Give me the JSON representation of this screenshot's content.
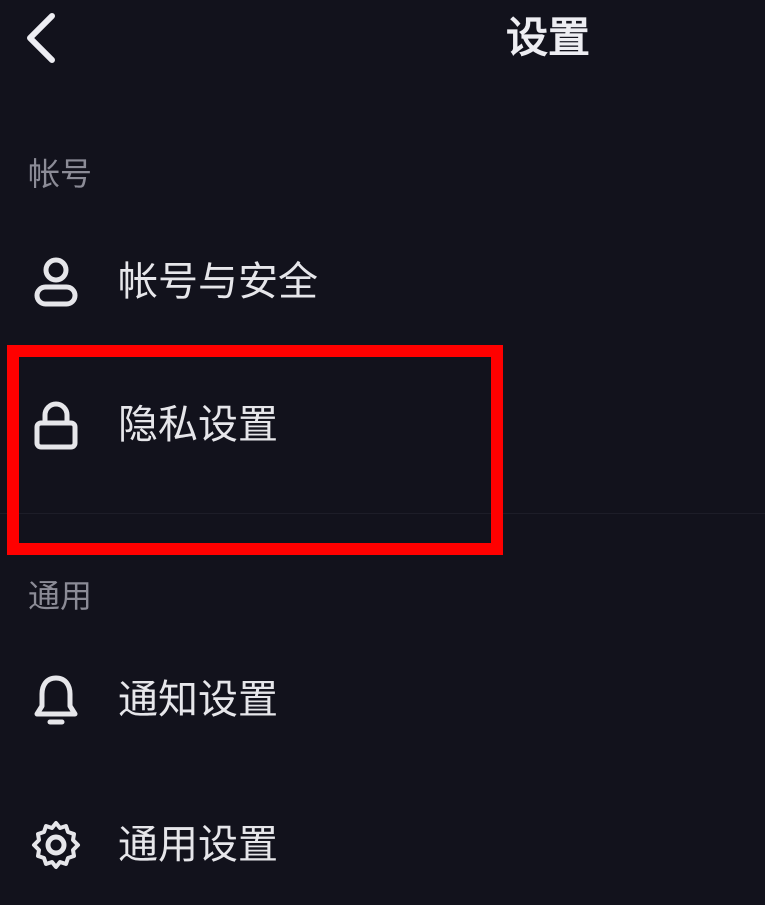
{
  "header": {
    "title": "设置",
    "back_icon": "chevron-left-icon"
  },
  "sections": [
    {
      "label": "帐号",
      "items": [
        {
          "label": "帐号与安全",
          "icon": "user-icon"
        },
        {
          "label": "隐私设置",
          "icon": "lock-icon",
          "highlighted": true
        }
      ]
    },
    {
      "label": "通用",
      "items": [
        {
          "label": "通知设置",
          "icon": "bell-icon"
        },
        {
          "label": "通用设置",
          "icon": "gear-icon"
        }
      ]
    }
  ],
  "colors": {
    "background": "#12121c",
    "text": "#e6e6ea",
    "section_label": "#8b8b96",
    "highlight": "#ff0000"
  }
}
